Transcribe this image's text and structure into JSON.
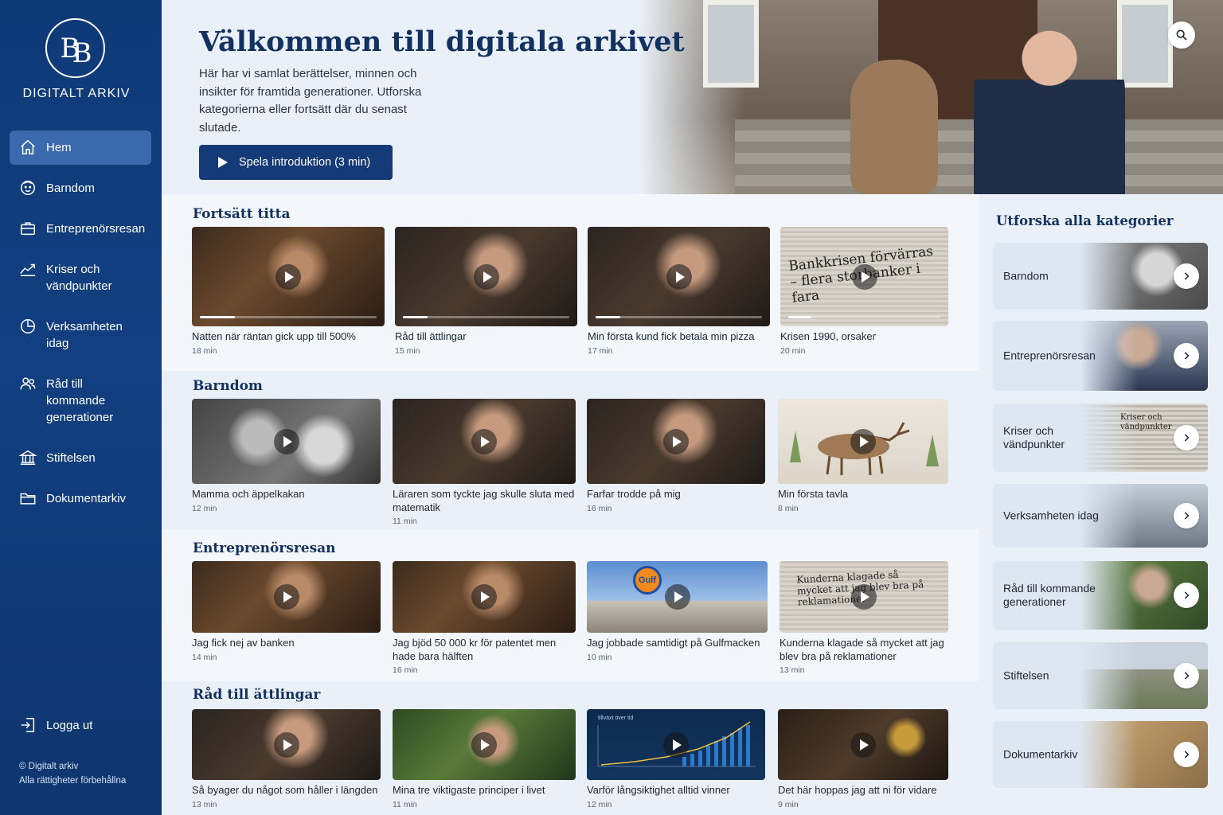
{
  "sidebar": {
    "logo_text": "BB",
    "brand": "DIGITALT ARKIV",
    "items": [
      {
        "label": "Hem",
        "icon": "home-icon"
      },
      {
        "label": "Barndom",
        "icon": "child-face-icon"
      },
      {
        "label": "Entreprenörsresan",
        "icon": "briefcase-icon"
      },
      {
        "label": "Kriser och vändpunkter",
        "icon": "trend-icon"
      },
      {
        "label": "Verksamheten idag",
        "icon": "pie-icon"
      },
      {
        "label": "Råd till kommande generationer",
        "icon": "people-icon"
      },
      {
        "label": "Stiftelsen",
        "icon": "bank-icon"
      },
      {
        "label": "Dokumentarkiv",
        "icon": "folder-icon"
      }
    ],
    "logout": "Logga ut",
    "copyright_1": "© Digitalt arkiv",
    "copyright_2": "Alla rättigheter förbehållna"
  },
  "hero": {
    "title": "Välkommen till digitala arkivet",
    "text": "Här har vi samlat berättelser, minnen och insikter för framtida generationer. Utforska kategorierna eller fortsätt där du senast slutade.",
    "button": "Spela introduktion (3 min)"
  },
  "continue": {
    "title": "Fortsätt titta",
    "items": [
      {
        "title": "Natten när räntan gick upp till 500%",
        "duration": "18 min",
        "progress": 0.2
      },
      {
        "title": "Råd till ättlingar",
        "duration": "15 min",
        "progress": 0.15
      },
      {
        "title": "Min första kund fick betala min pizza",
        "duration": "17 min",
        "progress": 0.15
      },
      {
        "title": "Krisen 1990, orsaker",
        "duration": "20 min",
        "progress": 0.15
      }
    ]
  },
  "barndom": {
    "title": "Barndom",
    "items": [
      {
        "title": "Mamma och äppelkakan",
        "duration": "12 min"
      },
      {
        "title": "Läraren som tyckte jag skulle sluta med matematik",
        "duration": "11 min"
      },
      {
        "title": "Farfar trodde på mig",
        "duration": "16 min"
      },
      {
        "title": "Min första tavla",
        "duration": "8 min"
      }
    ]
  },
  "entre": {
    "title": "Entreprenörsresan",
    "items": [
      {
        "title": "Jag fick nej av banken",
        "duration": "14 min"
      },
      {
        "title": "Jag bjöd 50 000 kr för patentet men hade bara hälften",
        "duration": "16 min"
      },
      {
        "title": "Jag jobbade samtidigt på Gulfmacken",
        "duration": "10 min"
      },
      {
        "title": "Kunderna klagade så mycket att jag blev bra på reklamationer",
        "duration": "13 min"
      }
    ]
  },
  "rad": {
    "title": "Råd till ättlingar",
    "items": [
      {
        "title": "Så byager du något som håller i längden",
        "duration": "13 min"
      },
      {
        "title": "Mina tre viktigaste principer i livet",
        "duration": "11 min"
      },
      {
        "title": "Varför långsiktighet alltid vinner",
        "duration": "12 min"
      },
      {
        "title": "Det här hoppas jag att ni för vidare",
        "duration": "9 min"
      }
    ]
  },
  "thumb_text": {
    "news_headline": "Bankkrisen förvärras – flera storbanker i fara",
    "gulf_sign": "Gulf",
    "ad_headline": "Kunderna klagade så mycket att jag blev bra på reklamationer",
    "chart_header": "tillväxt över tid",
    "kriser_news": "Kriser och vändpunkter"
  },
  "categories": {
    "title": "Utforska alla kategorier",
    "items": [
      {
        "label": "Barndom"
      },
      {
        "label": "Entreprenörsresan"
      },
      {
        "label": "Kriser och vändpunkter"
      },
      {
        "label": "Verksamheten idag"
      },
      {
        "label": "Råd till kommande generationer"
      },
      {
        "label": "Stiftelsen"
      },
      {
        "label": "Dokumentarkiv"
      }
    ]
  }
}
